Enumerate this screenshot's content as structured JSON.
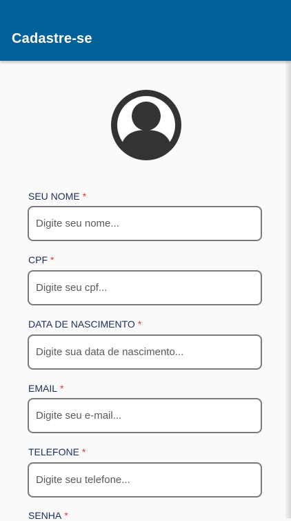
{
  "appbar": {
    "title": "Cadastre-se",
    "color": "#03619a"
  },
  "form": {
    "required_mark": "*",
    "fields": [
      {
        "label": "SEU NOME",
        "placeholder": "Digite seu nome..."
      },
      {
        "label": "CPF",
        "placeholder": "Digite seu cpf..."
      },
      {
        "label": "DATA DE NASCIMENTO",
        "placeholder": "Digite sua data de nascimento..."
      },
      {
        "label": "EMAIL",
        "placeholder": "Digite seu e-mail..."
      },
      {
        "label": "TELEFONE",
        "placeholder": "Digite seu telefone..."
      },
      {
        "label": "SENHA"
      }
    ]
  },
  "avatar": {
    "icon": "user-avatar-icon"
  }
}
